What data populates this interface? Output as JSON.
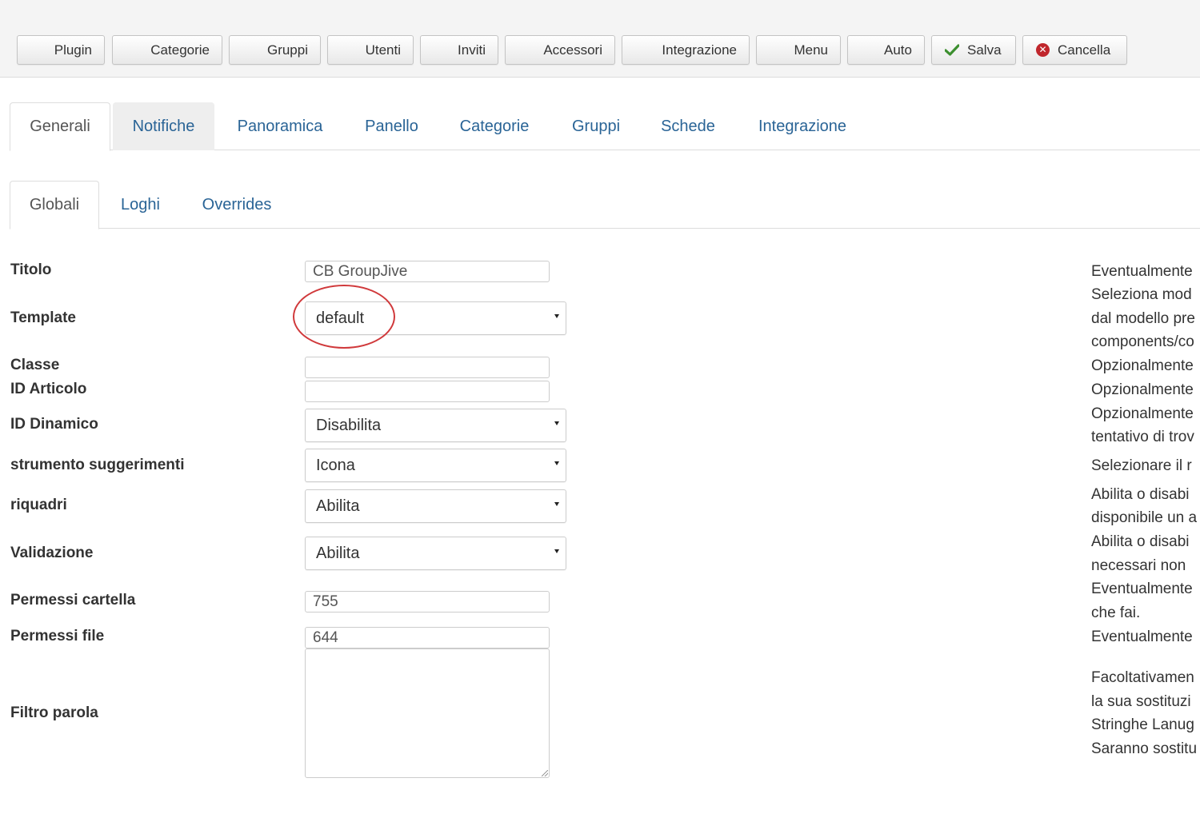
{
  "toolbar": {
    "buttons": [
      "Plugin",
      "Categorie",
      "Gruppi",
      "Utenti",
      "Inviti",
      "Accessori",
      "Integrazione",
      "Menu",
      "Auto"
    ],
    "save_label": "Salva",
    "cancel_label": "Cancella",
    "cancel_glyph": "✕"
  },
  "main_tabs": [
    "Generali",
    "Notifiche",
    "Panoramica",
    "Panello",
    "Categorie",
    "Gruppi",
    "Schede",
    "Integrazione"
  ],
  "sub_tabs": [
    "Globali",
    "Loghi",
    "Overrides"
  ],
  "form": {
    "titolo": {
      "label": "Titolo",
      "value": "CB GroupJive"
    },
    "template": {
      "label": "Template",
      "value": "default"
    },
    "classe": {
      "label": "Classe",
      "value": ""
    },
    "id_articolo": {
      "label": "ID Articolo",
      "value": ""
    },
    "id_dinamico": {
      "label": "ID Dinamico",
      "value": "Disabilita"
    },
    "suggerimenti": {
      "label": "strumento suggerimenti",
      "value": "Icona"
    },
    "riquadri": {
      "label": "riquadri",
      "value": "Abilita"
    },
    "validazione": {
      "label": "Validazione",
      "value": "Abilita"
    },
    "permessi_cartella": {
      "label": "Permessi cartella",
      "value": "755"
    },
    "permessi_file": {
      "label": "Permessi file",
      "value": "644"
    },
    "filtro_parola": {
      "label": "Filtro parola",
      "value": ""
    }
  },
  "descriptions": [
    "Eventualmente",
    "Seleziona mod",
    "dal modello pre",
    "components/co",
    "Opzionalmente",
    "Opzionalmente",
    "Opzionalmente",
    "tentativo di trov",
    "Selezionare il r",
    "Abilita o disabi",
    "disponibile un a",
    "Abilita o disabi",
    "necessari non",
    "Eventualmente",
    "che fai.",
    "Eventualmente",
    "Facoltativamen",
    "la sua sostituzi",
    "Stringhe Lanug",
    "Saranno sostitu"
  ],
  "colors": {
    "link": "#2a6496",
    "annotation": "#d0393b",
    "save_check": "#3c8f2f",
    "cancel_icon": "#c0262c"
  }
}
